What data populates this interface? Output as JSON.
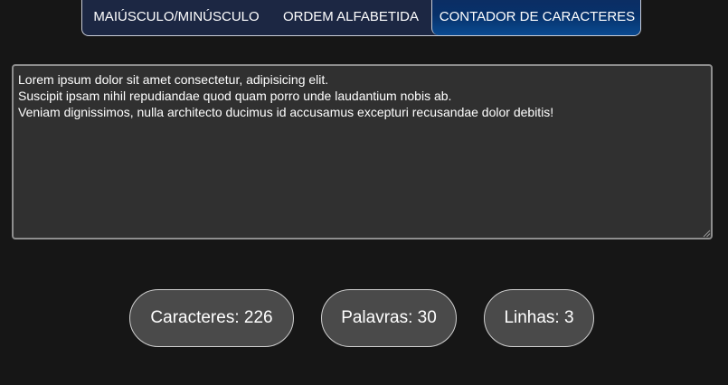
{
  "tabs": [
    {
      "label": "MAIÚSCULO/MINÚSCULO"
    },
    {
      "label": "ORDEM ALFABETIDA"
    },
    {
      "label": "CONTADOR DE CARACTERES",
      "active": true
    }
  ],
  "editor": {
    "value": "Lorem ipsum dolor sit amet consectetur, adipisicing elit.\nSuscipit ipsam nihil repudiandae quod quam porro unde laudantium nobis ab.\nVeniam dignissimos, nulla architecto ducimus id accusamus excepturi recusandae dolor debitis!"
  },
  "stats": {
    "characters": "Caracteres: 226",
    "words": "Palavras: 30",
    "lines": "Linhas: 3"
  },
  "colors": {
    "background": "#161616",
    "tab_bar": "#1c2743",
    "active_tab": "#07316a",
    "textarea": "#303030",
    "stat_pill": "#4a4a4a"
  }
}
